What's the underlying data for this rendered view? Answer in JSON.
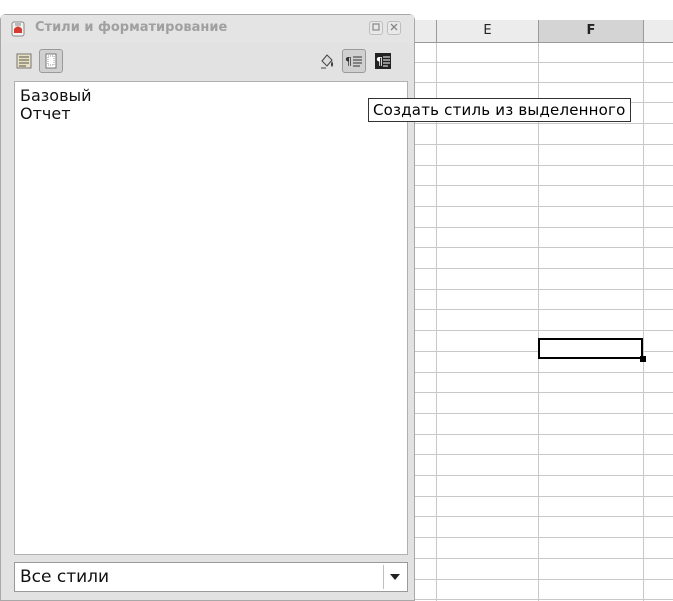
{
  "panel": {
    "title": "Стили и форматирование",
    "style_list": {
      "items": [
        "Базовый",
        "Отчет"
      ]
    },
    "filter": {
      "selected": "Все стили"
    }
  },
  "tooltip": {
    "text": "Создать стиль из выделенного"
  },
  "sheet": {
    "columns": [
      {
        "label": "E",
        "selected": false
      },
      {
        "label": "F",
        "selected": true
      }
    ]
  },
  "icons": {
    "title": "styles-format-icon",
    "toolbar": [
      "paragraph-styles-icon",
      "page-styles-icon",
      "fill-format-icon",
      "new-style-from-selection-icon",
      "update-style-icon"
    ],
    "window": [
      "restore-icon",
      "close-icon"
    ],
    "dropdown": "chevron-down-icon"
  },
  "colors": {
    "panel_bg": "#e2e2e2",
    "header_bg": "#ececec",
    "selected_header_bg": "#d4d4d4",
    "grid": "#c8c8c8"
  }
}
